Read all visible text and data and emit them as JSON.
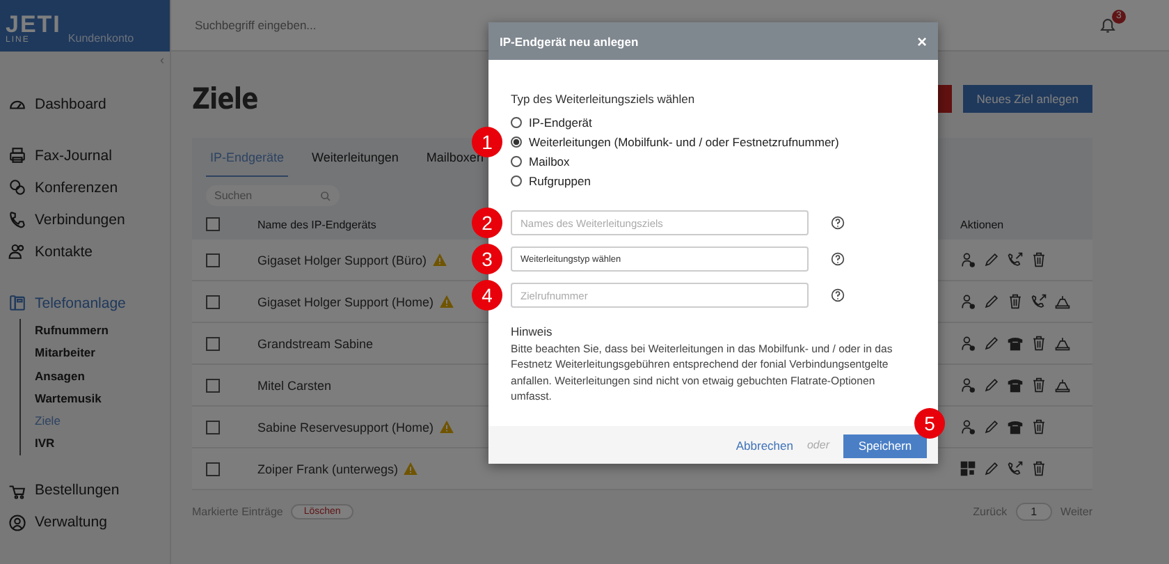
{
  "logo": {
    "mark": "JETI",
    "sub": "LINE",
    "account": "Kundenkonto"
  },
  "search": {
    "placeholder": "Suchbegriff eingeben..."
  },
  "notifications": {
    "count": "3"
  },
  "sidebar": {
    "collapse": "‹",
    "sections": [
      [
        {
          "label": "Dashboard",
          "selected": false
        }
      ],
      [
        {
          "label": "Fax-Journal",
          "selected": false
        },
        {
          "label": "Konferenzen",
          "selected": false
        },
        {
          "label": "Verbindungen",
          "selected": false
        },
        {
          "label": "Kontakte",
          "selected": false
        }
      ],
      [
        {
          "label": "Telefonanlage",
          "selected": true,
          "children": [
            {
              "label": "Rufnummern",
              "selected": false
            },
            {
              "label": "Mitarbeiter",
              "selected": false
            },
            {
              "label": "Ansagen",
              "selected": false
            },
            {
              "label": "Wartemusik",
              "selected": false
            },
            {
              "label": "Ziele",
              "selected": true
            },
            {
              "label": "IVR",
              "selected": false
            }
          ]
        }
      ],
      [
        {
          "label": "Bestellungen",
          "selected": false
        },
        {
          "label": "Verwaltung",
          "selected": false
        }
      ]
    ]
  },
  "page": {
    "title": "Ziele",
    "new_button": "Neues Ziel anlegen"
  },
  "tabs": [
    {
      "label": "IP-Endgeräte",
      "selected": true
    },
    {
      "label": "Weiterleitungen",
      "selected": false
    },
    {
      "label": "Mailboxen",
      "selected": false
    }
  ],
  "table": {
    "search_placeholder": "Suchen",
    "select_all_checked": false,
    "columns": [
      "Name des IP-Endgeräts",
      "Aktionen"
    ],
    "rows": [
      {
        "name": "Gigaset Holger Support (Büro)",
        "warning": true,
        "checked": false,
        "actions": [
          {
            "kind": "assign"
          },
          {
            "kind": "edit"
          },
          {
            "kind": "forward"
          },
          {
            "kind": "delete"
          }
        ]
      },
      {
        "name": "Gigaset Holger Support (Home)",
        "warning": true,
        "checked": false,
        "actions": [
          {
            "kind": "assign"
          },
          {
            "kind": "edit"
          },
          {
            "kind": "delete"
          },
          {
            "kind": "forward"
          },
          {
            "kind": "device"
          }
        ]
      },
      {
        "name": "Grandstream Sabine",
        "warning": false,
        "checked": false,
        "actions": [
          {
            "kind": "assign"
          },
          {
            "kind": "edit"
          },
          {
            "kind": "deskphone"
          },
          {
            "kind": "delete"
          },
          {
            "kind": "device"
          }
        ]
      },
      {
        "name": "Mitel Carsten",
        "warning": false,
        "checked": false,
        "actions": [
          {
            "kind": "assign"
          },
          {
            "kind": "edit"
          },
          {
            "kind": "deskphone"
          },
          {
            "kind": "delete"
          },
          {
            "kind": "device"
          }
        ]
      },
      {
        "name": "Sabine Reservesupport (Home)",
        "warning": true,
        "checked": false,
        "actions": [
          {
            "kind": "assign"
          },
          {
            "kind": "edit"
          },
          {
            "kind": "deskphone"
          },
          {
            "kind": "delete"
          }
        ]
      },
      {
        "name": "Zoiper Frank (unterwegs)",
        "warning": true,
        "checked": false,
        "actions": [
          {
            "kind": "qr"
          },
          {
            "kind": "edit"
          },
          {
            "kind": "forward"
          },
          {
            "kind": "delete"
          }
        ]
      }
    ]
  },
  "bulk": {
    "label": "Markierte Einträge",
    "button": "Löschen"
  },
  "pagination": {
    "prev": "Zurück",
    "page": "1",
    "next": "Weiter"
  },
  "modal": {
    "title": "IP-Endgerät neu anlegen",
    "close": "×",
    "prompt": "Typ des Weiterleitungsziels wählen",
    "options": [
      {
        "label": "IP-Endgerät",
        "selected": false
      },
      {
        "label": "Weiterleitungen (Mobilfunk- und / oder Festnetzrufnummer)",
        "selected": true,
        "marker": "1"
      },
      {
        "label": "Mailbox",
        "selected": false
      },
      {
        "label": "Rufgruppen",
        "selected": false
      }
    ],
    "fields": [
      {
        "kind": "input",
        "placeholder": "Names des Weiterleitungsziels",
        "marker": "2"
      },
      {
        "kind": "select",
        "value": "Weiterleitungstyp wählen",
        "marker": "3"
      },
      {
        "kind": "input",
        "placeholder": "Zielrufnummer",
        "marker": "4"
      }
    ],
    "note_title": "Hinweis",
    "note": "Bitte beachten Sie, dass bei Weiterleitungen in das Mobilfunk- und / oder in das Festnetz Weiterleitungsgebühren entsprechend der fonial Verbindungsentgelte anfallen. Weiterleitungen sind nicht von etwaig gebuchten Flatrate-Optionen umfasst.",
    "cancel": "Abbrechen",
    "or": "oder",
    "save": "Speichern",
    "save_marker": "5"
  }
}
